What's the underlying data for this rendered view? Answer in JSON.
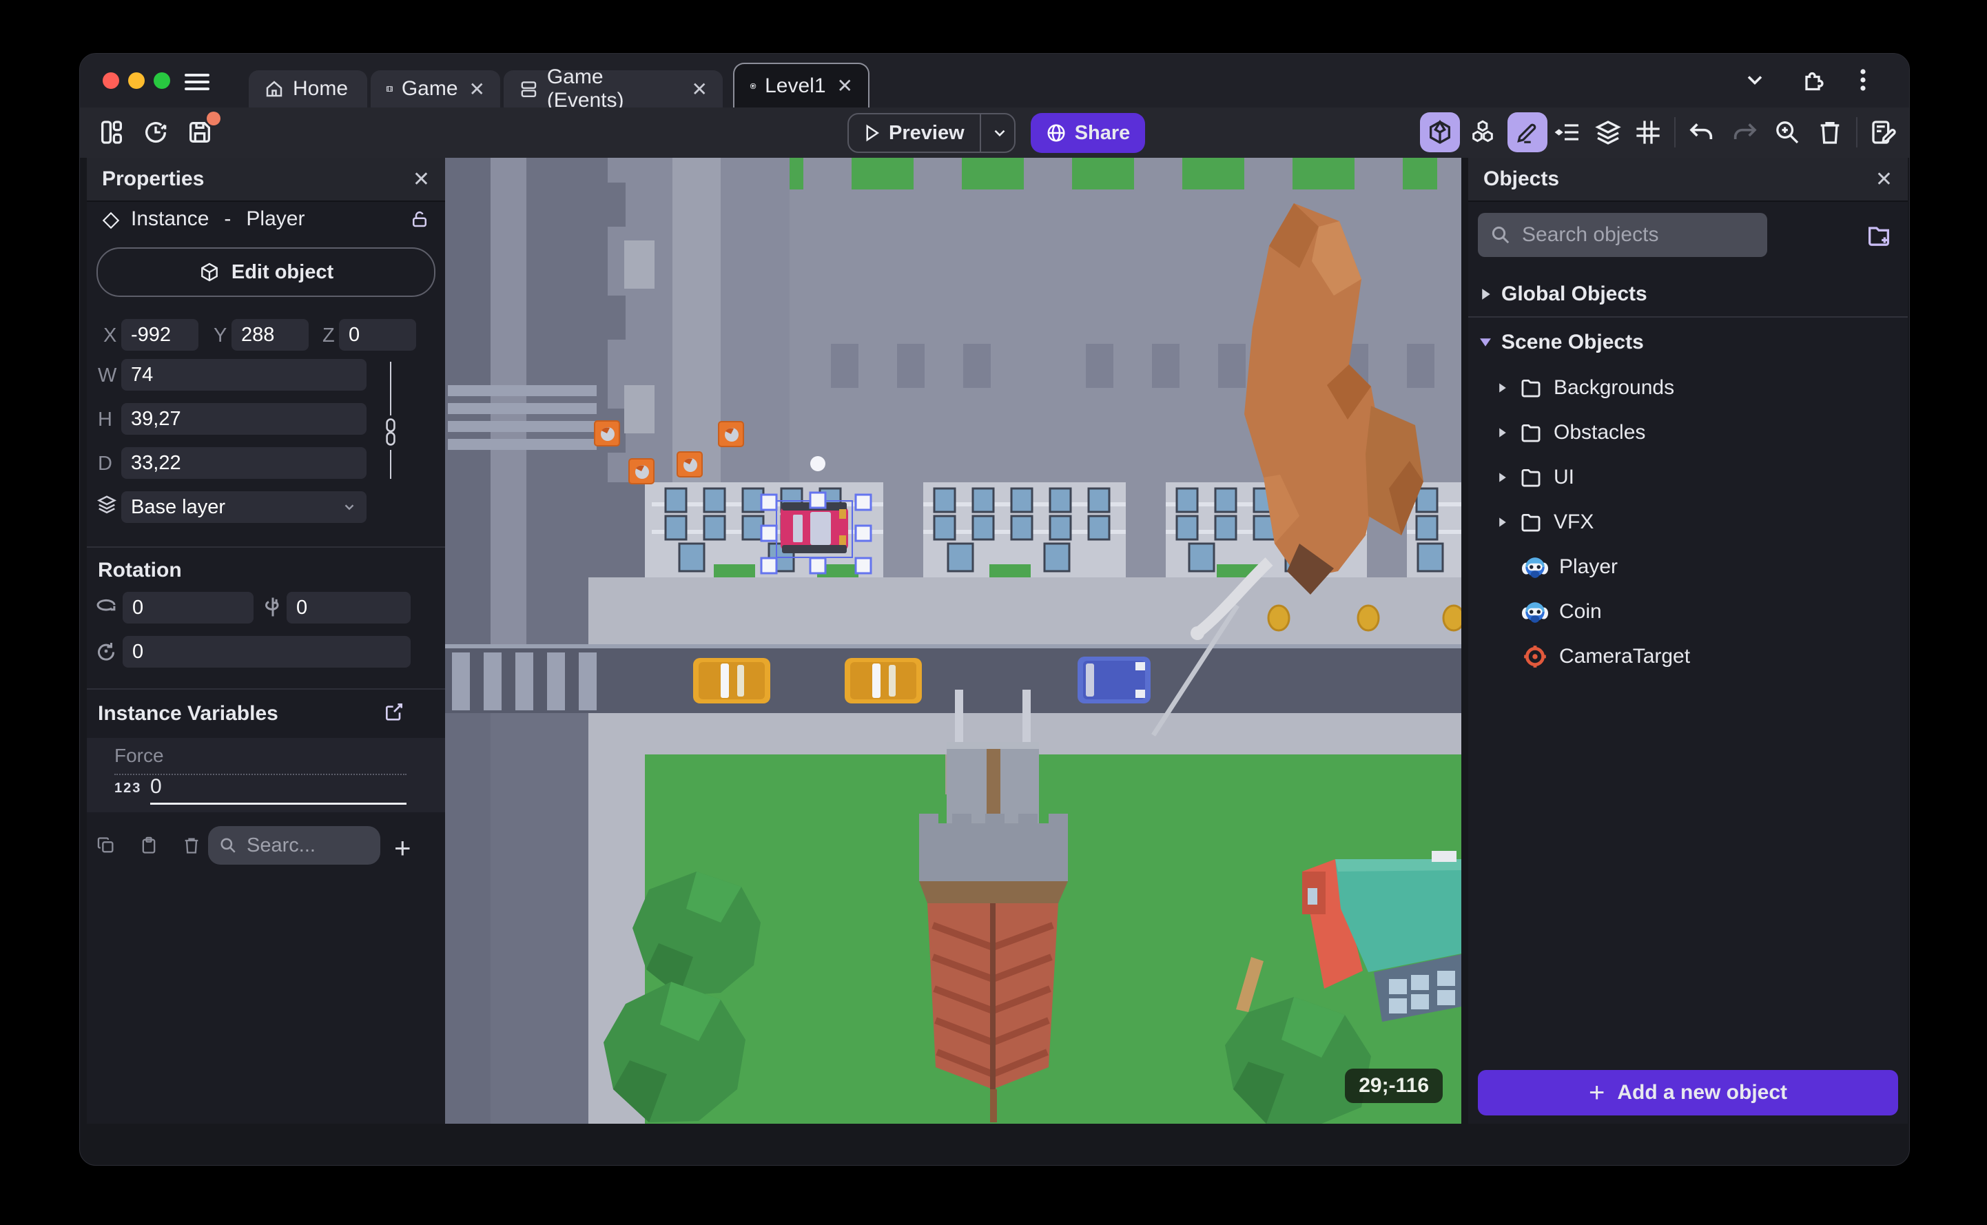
{
  "tabs": {
    "items": [
      {
        "label": "Home"
      },
      {
        "label": "Game",
        "close": "✕"
      },
      {
        "label": "Game (Events)",
        "close": "✕"
      },
      {
        "label": "Level1",
        "close": "✕"
      }
    ]
  },
  "toolbar": {
    "preview_label": "Preview",
    "share_label": "Share",
    "icons": [
      "layout-icon",
      "history-icon",
      "save-icon",
      "cube-3d-icon",
      "objects-cubes-icon",
      "pencil-icon",
      "instances-list-icon",
      "layers-icon",
      "grid-icon",
      "undo-icon",
      "redo-icon",
      "zoom-in-icon",
      "trash-icon",
      "scene-edit-icon"
    ]
  },
  "properties": {
    "title": "Properties",
    "instance_type": "Instance",
    "separator": "-",
    "object_name": "Player",
    "edit_object_label": "Edit object",
    "coords": {
      "x_label": "X",
      "x": "-992",
      "y_label": "Y",
      "y": "288",
      "z_label": "Z",
      "z": "0"
    },
    "size": {
      "w_label": "W",
      "w": "74",
      "h_label": "H",
      "h": "39,27",
      "d_label": "D",
      "d": "33,22"
    },
    "layer": "Base layer",
    "rotation_title": "Rotation",
    "rotation": {
      "rx": "0",
      "ry": "0",
      "rz": "0"
    },
    "variables_title": "Instance Variables",
    "variable": {
      "name": "Force",
      "type_badge": "123",
      "value": "0"
    },
    "search_placeholder": "Searc..."
  },
  "objects": {
    "title": "Objects",
    "search_placeholder": "Search objects",
    "global_group": "Global Objects",
    "scene_group": "Scene Objects",
    "folders": [
      {
        "label": "Backgrounds"
      },
      {
        "label": "Obstacles"
      },
      {
        "label": "UI"
      },
      {
        "label": "VFX"
      }
    ],
    "items": [
      {
        "label": "Player",
        "icon": "monkey-icon"
      },
      {
        "label": "Coin",
        "icon": "monkey-icon"
      },
      {
        "label": "CameraTarget",
        "icon": "target-icon"
      }
    ],
    "add_button_label": "Add a new object"
  },
  "canvas": {
    "coordinates_badge": "29;-116"
  },
  "colors": {
    "accent_purple": "#5b2fd8",
    "toolbar_highlight": "#b3a4ee",
    "traffic_red": "#ff5f57",
    "traffic_yellow": "#febc2e",
    "traffic_green": "#28c840",
    "grass": "#4da550",
    "road": "#6d7183",
    "road_dark": "#575b6c",
    "sidewalk": "#b5b8c3",
    "brick": "#b45f49",
    "teal_building": "#4fb6a0",
    "crate_orange": "#e8762c",
    "selection_blue": "#6474ee",
    "coin_gold": "#d8a62e",
    "car_pink": "#d5336c",
    "car_yellow": "#e8a72c",
    "car_blue": "#5a6fd0"
  }
}
